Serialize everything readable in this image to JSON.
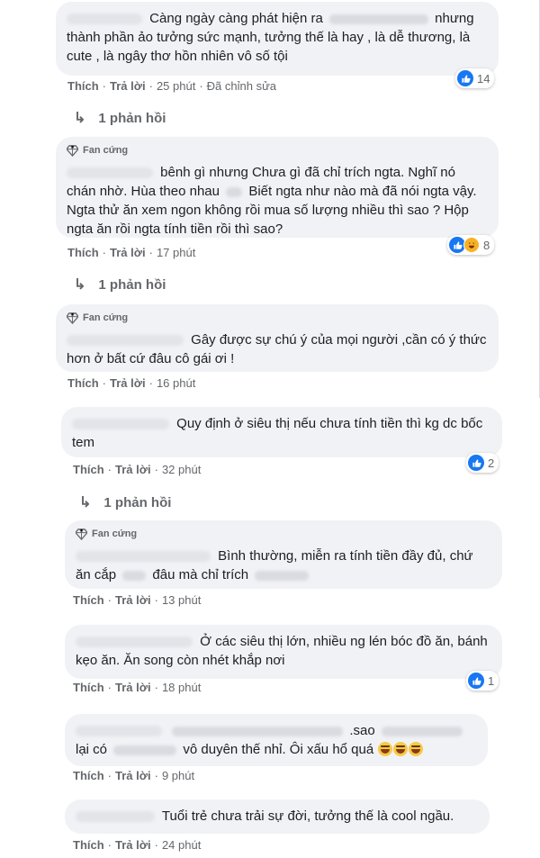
{
  "comments": [
    {
      "text": "Càng ngày càng phát hiện ra",
      "text_after": "nhưng thành phần ảo tưởng sức mạnh, tưởng thế là hay , là dễ thương, là cute , là ngây thơ hồn nhiên vô số tội",
      "actions": {
        "like": "Thích",
        "reply": "Trả lời",
        "time": "25 phút",
        "edited": "Đã chỉnh sửa"
      },
      "reactions": "14",
      "replies": "1 phản hồi"
    },
    {
      "badge": "Fan cứng",
      "text": "bênh gì nhưng Chưa gì đã chỉ trích ngta. Nghĩ nó chán nhờ. Hùa theo nhau",
      "text_after": "Biết ngta như nào mà đã nói ngta vậy. Ngta thử ăn xem ngon không rồi mua số lượng nhiều thì sao ? Hộp ngta ăn rồi ngta tính tiền rồi thì sao?",
      "actions": {
        "like": "Thích",
        "reply": "Trả lời",
        "time": "17 phút"
      },
      "reactions": "8",
      "replies": "1 phản hồi"
    },
    {
      "badge": "Fan cứng",
      "text": "Gây được sự chú ý của mọi người ,cần có ý thức hơn ở bất cứ đâu cô gái ơi !",
      "actions": {
        "like": "Thích",
        "reply": "Trả lời",
        "time": "16 phút"
      }
    },
    {
      "text": "Quy định ở siêu thị nếu chưa tính tiền thì kg dc bốc tem",
      "actions": {
        "like": "Thích",
        "reply": "Trả lời",
        "time": "32 phút"
      },
      "reactions": "2",
      "replies": "1 phản hồi"
    },
    {
      "badge": "Fan cứng",
      "text": "Bình thường, miễn ra tính tiền đầy đủ, chứ ăn cắp",
      "text_after": "đâu mà chỉ trích",
      "actions": {
        "like": "Thích",
        "reply": "Trả lời",
        "time": "13 phút"
      }
    },
    {
      "text": "Ở các siêu thị lớn, nhiều ng lén bóc đồ ăn, bánh kẹo ăn. Ăn song còn nhét khắp nơi",
      "actions": {
        "like": "Thích",
        "reply": "Trả lời",
        "time": "18 phút"
      },
      "reactions": "1"
    },
    {
      "text": ".sao",
      "text_mid": "lại có",
      "text_after": "vô duyên thế nhỉ. Ôi xấu hổ quá",
      "actions": {
        "like": "Thích",
        "reply": "Trả lời",
        "time": "9 phút"
      }
    },
    {
      "text": "Tuổi trẻ chưa trải sự đời, tưởng thế là cool ngầu.",
      "actions": {
        "like": "Thích",
        "reply": "Trả lời",
        "time": "24 phút"
      }
    }
  ],
  "icons": {
    "badge": "diamond-icon",
    "reply_arrow": "reply-arrow-icon",
    "like": "like-icon",
    "haha": "haha-icon",
    "laugh_emoji": "laughing-emoji-icon"
  },
  "colors": {
    "bubble": "#f0f2f5",
    "like_blue": "#1877f2",
    "meta_gray": "#65676b"
  }
}
